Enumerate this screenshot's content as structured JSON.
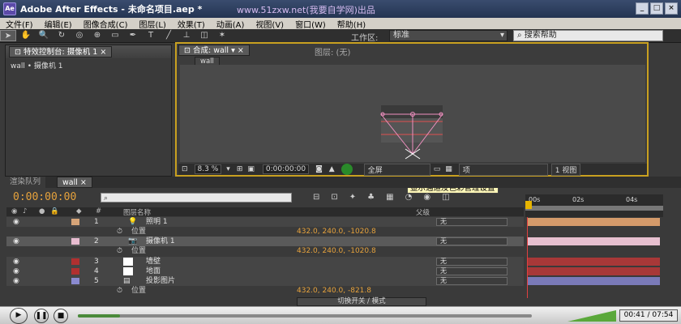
{
  "window": {
    "title": "Adobe After Effects - 未命名项目.aep *",
    "watermark": "www.51zxw.net(我要自学网)出品",
    "min": "_",
    "max": "□",
    "close": "×"
  },
  "menu": [
    "文件(F)",
    "编辑(E)",
    "图像合成(C)",
    "图层(L)",
    "效果(T)",
    "动画(A)",
    "视图(V)",
    "窗口(W)",
    "帮助(H)"
  ],
  "toolbar": {
    "workspace_label": "工作区:",
    "workspace_value": "标准",
    "help_placeholder": "搜索帮助"
  },
  "effects_panel": {
    "tab": "特效控制台: 摄像机 1",
    "path": "wall • 摄像机 1"
  },
  "comp_panel": {
    "tab": "合成: wall",
    "layer_tab": "图层: (无)",
    "comp_name": "wall",
    "zoom": "8.3 %",
    "timecode": "0:00:00:00",
    "resolution": "全屏",
    "view_mode": "项",
    "views": "1 视图"
  },
  "tooltip": "显示通道及色彩管理设置",
  "timeline": {
    "tabs": [
      "渲染队列",
      "wall"
    ],
    "current_time": "0:00:00:00",
    "search_placeholder": "",
    "col_name": "图层名称",
    "col_num": "#",
    "col_parent": "父级",
    "ruler": [
      "00s",
      "02s",
      "04s"
    ],
    "switch_label": "切换开关 / 模式",
    "layers": [
      {
        "num": "1",
        "name": "照明 1",
        "color": "#d6a478",
        "mode": "无",
        "sub": "位置",
        "value": "432.0, 240.0, -1020.8",
        "bar": "#d49a6a"
      },
      {
        "num": "2",
        "name": "摄像机 1",
        "color": "#e8bcd0",
        "mode": "无",
        "sub": "位置",
        "value": "432.0, 240.0, -1020.8",
        "bar": "#e7c0d0"
      },
      {
        "num": "3",
        "name": "墙壁",
        "color": "#b03030",
        "mode": "无",
        "bar": "#a83838"
      },
      {
        "num": "4",
        "name": "地面",
        "color": "#b03030",
        "mode": "无",
        "bar": "#a83838"
      },
      {
        "num": "5",
        "name": "投影图片",
        "color": "#8a8ad0",
        "mode": "无",
        "sub": "位置",
        "value": "432.0, 240.0, -821.8",
        "bar": "#7a7ab8"
      }
    ]
  },
  "player": {
    "time": "00:41 / 07:54",
    "progress": 0.093
  }
}
